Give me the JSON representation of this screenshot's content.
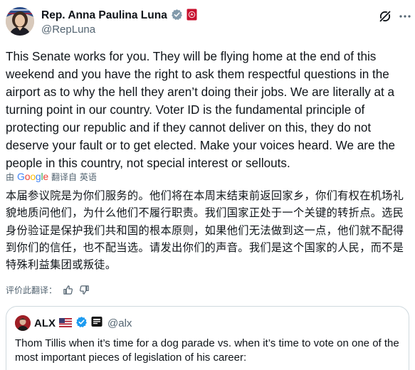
{
  "author": {
    "display_name": "Rep. Anna Paulina Luna",
    "handle": "@RepLuna",
    "verified_badge": "government-verified-badge-icon",
    "affiliation_badge": "house-of-representatives-seal-icon"
  },
  "tweet": {
    "text": "This Senate works for you. They will be flying home at the end of this weekend and you have the right to ask them respectful questions in the airport as to why the hell they aren’t doing their jobs. We are literally at a turning point in our country. Voter ID is the fundamental principle of protecting our republic and if they cannot deliver on this, they do not deserve your fault or to get elected. Make your voices heard. We are the people in this country, not special interest or sellouts."
  },
  "translation": {
    "by_label": "由",
    "provider": "Google",
    "link_label": "翻译自 英语",
    "text": "本届参议院是为你们服务的。他们将在本周末结束前返回家乡，你们有权在机场礼貌地质问他们，为什么他们不履行职责。我们国家正处于一个关键的转折点。选民身份验证是保护我们共和国的根本原则，如果他们无法做到这一点，他们就不配得到你们的信任，也不配当选。请发出你们的声音。我们是这个国家的人民，而不是特殊利益集团或叛徒。",
    "rate_label": "评价此翻译："
  },
  "quote": {
    "display_name": "ALX",
    "handle": "@alx",
    "text": "Thom Tillis when it’s time for a dog parade vs. when it’s time to vote on one of the most important pieces of legislation of his career:"
  },
  "colors": {
    "text_primary": "#0f1419",
    "text_secondary": "#536471",
    "verified_gray": "#829aab",
    "verified_blue": "#1d9bf0",
    "border": "#cfd9de",
    "seal_red": "#c8102e"
  },
  "icons": {
    "grok": "grok-icon",
    "more": "more-options-icon",
    "thumbs_up": "thumbs-up-icon",
    "thumbs_down": "thumbs-down-icon",
    "us_flag": "us-flag-icon",
    "affiliate": "affiliate-badge-icon"
  }
}
